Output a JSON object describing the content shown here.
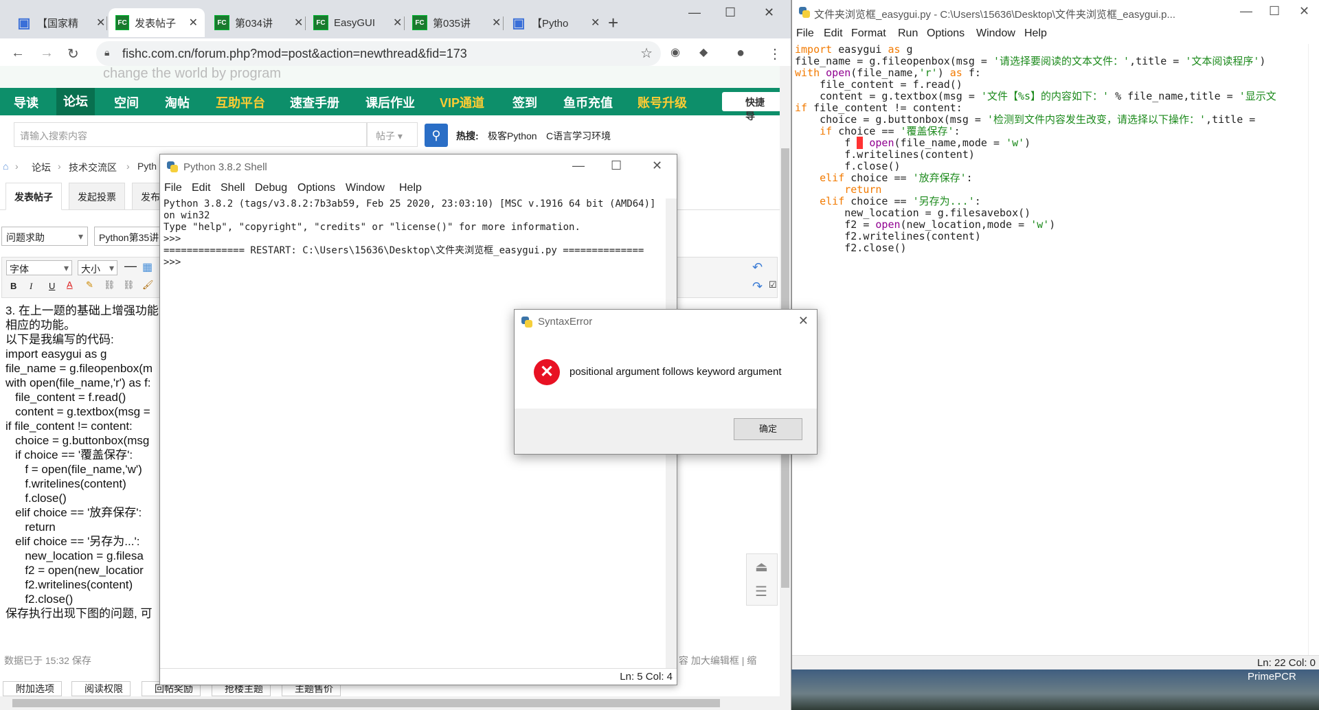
{
  "browser": {
    "tabs": [
      {
        "icon": "calendar-icon",
        "label": "【国家精"
      },
      {
        "icon": "fc-icon",
        "label": "发表帖子"
      },
      {
        "icon": "fc-icon",
        "label": "第034讲"
      },
      {
        "icon": "fc-icon",
        "label": "EasyGUI"
      },
      {
        "icon": "fc-icon",
        "label": "第035讲"
      },
      {
        "icon": "calendar-icon",
        "label": "【Pytho"
      }
    ],
    "url": "fishc.com.cn/forum.php?mod=post&action=newthread&fid=173"
  },
  "site": {
    "banner_text": "change the world by program",
    "nav": [
      "导读",
      "论坛",
      "空间",
      "淘帖",
      "互助平台",
      "速查手册",
      "课后作业",
      "VIP通道",
      "签到",
      "鱼币充值",
      "账号升级"
    ],
    "quick_link": "快捷导",
    "search_placeholder": "请输入搜索内容",
    "search_type": "帖子",
    "hot_label": "热搜:",
    "hot_items": [
      "极客Python",
      "C语言学习环境"
    ],
    "crumbs": [
      "论坛",
      "技术交流区",
      "Pyth"
    ],
    "post_tabs": [
      "发表帖子",
      "发起投票",
      "发布"
    ],
    "type_select": "问题求助",
    "title_value": "Python第35讲",
    "font_select": "字体",
    "size_select": "大小",
    "editor_lines": [
      "3. 在上一题的基础上增强功能",
      "相应的功能。",
      "以下是我编写的代码:",
      "import easygui as g",
      "file_name = g.fileopenbox(m",
      "with open(file_name,'r') as f:",
      "   file_content = f.read()",
      "   content = g.textbox(msg =",
      "if file_content != content:",
      "   choice = g.buttonbox(msg",
      "   if choice == '覆盖保存':",
      "      f = open(file_name,'w')",
      "      f.writelines(content)",
      "      f.close()",
      "   elif choice == '放弃保存':",
      "      return",
      "   elif choice == '另存为...':",
      "      new_location = g.filesa",
      "      f2 = open(new_locatior",
      "      f2.writelines(content)",
      "      f2.close()",
      "保存执行出现下图的问题, 可"
    ],
    "status_left": "数据已于 15:32 保存",
    "status_right": "容   加大编辑框 | 缩",
    "extra_tabs": [
      "附加选项",
      "阅读权限",
      "回帖奖励",
      "抢楼主题",
      "主题售价"
    ]
  },
  "idle_editor": {
    "title": "文件夹浏览框_easygui.py - C:\\Users\\15636\\Desktop\\文件夹浏览框_easygui.p...",
    "menu": [
      "File",
      "Edit",
      "Format",
      "Run",
      "Options",
      "Window",
      "Help"
    ],
    "status": "Ln: 22  Col: 0"
  },
  "desktop_label": "PrimePCR",
  "shell": {
    "title": "Python 3.8.2 Shell",
    "menu": [
      "File",
      "Edit",
      "Shell",
      "Debug",
      "Options",
      "Window",
      "Help"
    ],
    "output": "Python 3.8.2 (tags/v3.8.2:7b3ab59, Feb 25 2020, 23:03:10) [MSC v.1916 64 bit (AMD64)] on win32\nType \"help\", \"copyright\", \"credits\" or \"license()\" for more information.\n>>> \n============== RESTART: C:\\Users\\15636\\Desktop\\文件夹浏览框_easygui.py ==============\n>>> ",
    "status": "Ln: 5   Col: 4"
  },
  "dialog": {
    "title": "SyntaxError",
    "message": "positional argument follows keyword argument",
    "ok_label": "确定"
  }
}
